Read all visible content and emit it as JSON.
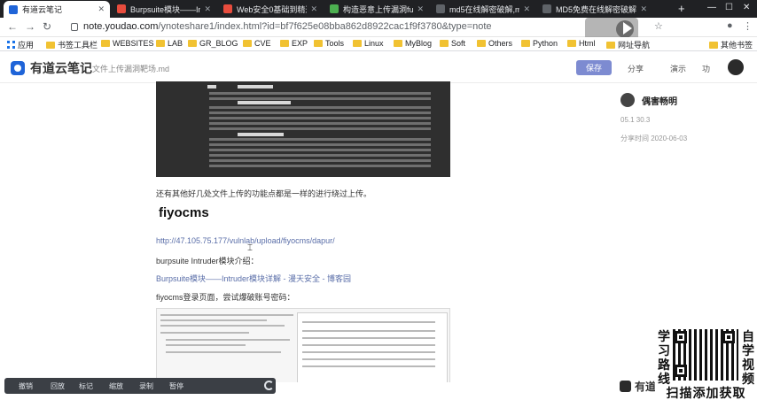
{
  "browser": {
    "tabs": [
      {
        "title": "有道云笔记",
        "active": true,
        "favicon_color": "#1f64d8"
      },
      {
        "title": "Burpsuite模块——Intr",
        "active": false,
        "favicon_color": "#e84c3d"
      },
      {
        "title": "Web安全0基础到精通",
        "active": false,
        "favicon_color": "#e84c3d"
      },
      {
        "title": "构造恶意上传漏洞fuzz",
        "active": false,
        "favicon_color": "#4caf50"
      },
      {
        "title": "md5在线解密破解,md",
        "active": false,
        "favicon_color": "#5f6368"
      },
      {
        "title": "MD5免费在线解密破解",
        "active": false,
        "favicon_color": "#5f6368"
      }
    ],
    "url_host": "note.youdao.com",
    "url_path": "/ynoteshare1/index.html?id=bf7f625e08bba862d8922cac1f9f3780&type=note",
    "bookmarks": [
      {
        "label": "应用",
        "icon": "apps-grid-icon"
      },
      {
        "label": "书签工具栏",
        "icon": "folder-icon"
      },
      {
        "label": "WEBSITES",
        "icon": "folder-icon"
      },
      {
        "label": "LAB",
        "icon": "folder-icon"
      },
      {
        "label": "GR_BLOG",
        "icon": "folder-icon"
      },
      {
        "label": "CVE",
        "icon": "folder-icon"
      },
      {
        "label": "EXP",
        "icon": "folder-icon"
      },
      {
        "label": "Tools",
        "icon": "folder-icon"
      },
      {
        "label": "Linux",
        "icon": "folder-icon"
      },
      {
        "label": "MyBlog",
        "icon": "folder-icon"
      },
      {
        "label": "Soft",
        "icon": "folder-icon"
      },
      {
        "label": "Others",
        "icon": "folder-icon"
      },
      {
        "label": "Python",
        "icon": "folder-icon"
      },
      {
        "label": "Html",
        "icon": "folder-icon"
      },
      {
        "label": "网址导航",
        "icon": "folder-icon"
      },
      {
        "label": "其他书签",
        "icon": "folder-icon"
      }
    ]
  },
  "app": {
    "logo_text": "有道云笔记",
    "doc_title": "文件上传漏洞靶场.md",
    "save_label": "保存",
    "share_label": "分享",
    "present_label": "演示",
    "more_label": "功"
  },
  "side": {
    "author_name": "偶害畅明",
    "meta_line1": "05.1 30.3",
    "meta_line2": "分享时间  2020-06-03"
  },
  "doc": {
    "para_intro": "还有其他好几处文件上传的功能点都是一样的进行绕过上传。",
    "heading": "fiyocms",
    "url_text": "http://47.105.75.177/vulnlab/upload/fiyocms/dapur/",
    "intruder_title": "burpsuite Intruder模块介绍：",
    "intruder_link": "Burpsuite模块——Intruder模块详解 - 漫天安全 - 博客园",
    "login_text": "fiyocms登录页面，尝试爆破账号密码："
  },
  "bottombar": {
    "items": [
      "撤销",
      "回放",
      "标记",
      "缩放",
      "录制",
      "暂停"
    ]
  },
  "bottom_logo_text": "有道",
  "promo": {
    "left_chars": "学习路线",
    "right_chars": "自学视频",
    "caption": "扫描添加获取"
  },
  "colors": {
    "save_button": "#7d8bd1",
    "link": "#5a6ea8",
    "tab_strip": "#202124"
  }
}
